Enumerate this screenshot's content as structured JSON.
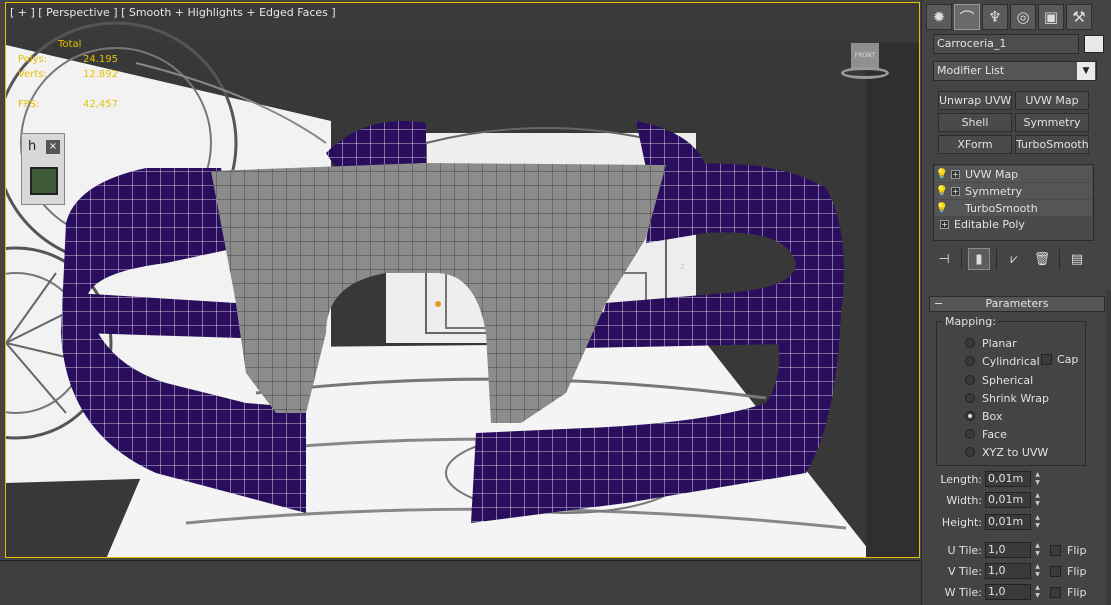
{
  "viewport": {
    "label": "[ + ] [ Perspective ] [ Smooth + Highlights + Edged Faces ]",
    "stats": {
      "header": "Total",
      "rows": [
        {
          "label": "Polys:",
          "value": "24.195"
        },
        {
          "label": "Verts:",
          "value": "12.892"
        },
        {
          "label": "FPS:",
          "value": "42,457"
        }
      ]
    },
    "widget": {
      "h": "h",
      "close": "×"
    },
    "viewcube_label": "FRONT",
    "axis_label": "z"
  },
  "panel": {
    "tabs": [
      {
        "icon": "sun-icon",
        "glyph": "✹"
      },
      {
        "icon": "curve-icon",
        "glyph": "⌒"
      },
      {
        "icon": "hierarchy-icon",
        "glyph": "♆"
      },
      {
        "icon": "motion-icon",
        "glyph": "◎"
      },
      {
        "icon": "display-icon",
        "glyph": "▣"
      },
      {
        "icon": "utilities-icon",
        "glyph": "⚒"
      }
    ],
    "object_name": "Carroceria_1",
    "modifier_list": "Modifier List",
    "modifier_buttons": [
      "Unwrap UVW",
      "UVW Map",
      "Shell",
      "Symmetry",
      "XForm",
      "TurboSmooth"
    ],
    "stack": [
      {
        "label": "UVW Map",
        "expand": true,
        "bulb": true
      },
      {
        "label": "Symmetry",
        "expand": true,
        "bulb": true
      },
      {
        "label": "TurboSmooth",
        "expand": false,
        "bulb": true
      },
      {
        "label": "Editable Poly",
        "expand": true,
        "bulb": false
      }
    ],
    "rollout": {
      "title": "Parameters",
      "mapping_label": "Mapping:",
      "options": [
        "Planar",
        "Cylindrical",
        "Spherical",
        "Shrink Wrap",
        "Box",
        "Face",
        "XYZ to UVW"
      ],
      "selected": "Box",
      "cap_label": "Cap",
      "length_label": "Length:",
      "length": "0,01m",
      "width_label": "Width:",
      "width": "0,01m",
      "height_label": "Height:",
      "height": "0,01m",
      "u_tile_label": "U Tile:",
      "u_tile": "1,0",
      "v_tile_label": "V Tile:",
      "v_tile": "1,0",
      "w_tile_label": "W Tile:",
      "w_tile": "1,0",
      "flip_label": "Flip"
    }
  },
  "colors": {
    "viewport_border": "#e5c100",
    "mesh_purple": "#2a0d5c",
    "mesh_gray": "#8a8a8a",
    "panel_bg": "#444444"
  }
}
